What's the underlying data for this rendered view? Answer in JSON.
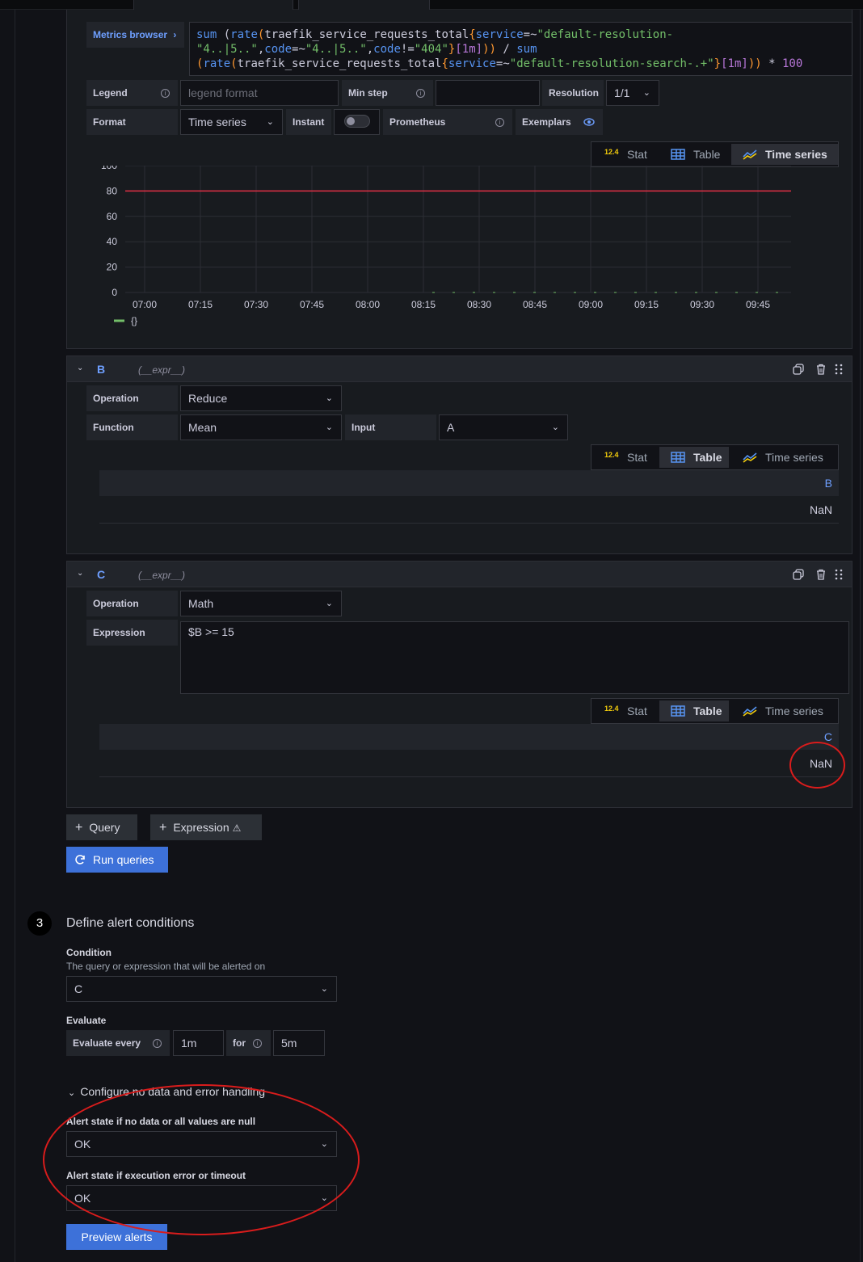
{
  "query_a": {
    "metrics_browser_label": "Metrics browser",
    "metrics_browser_chevron": "›",
    "code_line1_fn": "sum",
    "code_line1_rest_open": " (",
    "code_line1_rate": "rate",
    "code_line1_paren": "(",
    "code_line1_metric": "traefik_service_requests_total",
    "code_line1_brace": "{",
    "code_line1_label": "service",
    "code_line1_op": "=~",
    "code_line1_str": "\"default-resolution-",
    "code_line2_str": "\"4..|5..\"",
    "code_line2_comma": ",",
    "code_line2_label": "code",
    "code_line2_op": "=~",
    "code_line2_comma2": ",",
    "code_line2_label2": "code",
    "code_line2_op2": "!=",
    "code_line2_str2": "\"404\"",
    "code_line2_brace": "}",
    "code_line2_range": "[1m]",
    "code_line2_close": "))",
    "code_line2_div": " / ",
    "code_line2_fn": "sum",
    "code_line3_open": "(",
    "code_line3_rate": "rate",
    "code_line3_paren": "(",
    "code_line3_metric": "traefik_service_requests_total",
    "code_line3_brace": "{",
    "code_line3_label": "service",
    "code_line3_op": "=~",
    "code_line3_str": "\"default-resolution-search-.+\"",
    "code_line3_brace2": "}",
    "code_line3_range": "[1m]",
    "code_line3_close": "))",
    "code_line3_mul": " * ",
    "code_line3_num": "100",
    "legend_label": "Legend",
    "legend_placeholder": "legend format",
    "min_step_label": "Min step",
    "min_step_value": "",
    "resolution_label": "Resolution",
    "resolution_value": "1/1",
    "format_label": "Format",
    "format_value": "Time series",
    "instant_label": "Instant",
    "prometheus_label": "Prometheus",
    "exemplars_label": "Exemplars",
    "viz_tabs": [
      "Stat",
      "Table",
      "Time series"
    ],
    "active_tab": "Time series",
    "stat_icon_text": "12.4",
    "legend_item": "{}"
  },
  "chart_data": {
    "type": "line",
    "y_ticks": [
      "0",
      "20",
      "40",
      "60",
      "80",
      "100"
    ],
    "x_ticks": [
      "07:00",
      "07:15",
      "07:30",
      "07:45",
      "08:00",
      "08:15",
      "08:30",
      "08:45",
      "09:00",
      "09:15",
      "09:30",
      "09:45"
    ],
    "ylim": [
      0,
      100
    ],
    "series": [
      {
        "name": "{}",
        "color": "#73bf69",
        "values": [
          0
        ]
      }
    ],
    "threshold": {
      "value": 80,
      "color": "#e02f44"
    },
    "grid": true,
    "legend_placement": "bottom-left"
  },
  "query_b": {
    "refid": "B",
    "expr_tag": "(__expr__)",
    "operation_label": "Operation",
    "operation_value": "Reduce",
    "function_label": "Function",
    "function_value": "Mean",
    "input_label": "Input",
    "input_value": "A",
    "viz_tabs": [
      "Stat",
      "Table",
      "Time series"
    ],
    "active_tab": "Table",
    "table_header": "B",
    "table_value": "NaN"
  },
  "query_c": {
    "refid": "C",
    "expr_tag": "(__expr__)",
    "operation_label": "Operation",
    "operation_value": "Math",
    "expression_label": "Expression",
    "expression_value": "$B >= 15",
    "viz_tabs": [
      "Stat",
      "Table",
      "Time series"
    ],
    "active_tab": "Table",
    "table_header": "C",
    "table_value": "NaN"
  },
  "actions": {
    "query_button": "Query",
    "expression_button": "Expression",
    "run_queries_button": "Run queries",
    "plus": "+",
    "warn": "⚠"
  },
  "section3": {
    "step": "3",
    "title": "Define alert conditions",
    "condition_title": "Condition",
    "condition_desc": "The query or expression that will be alerted on",
    "condition_value": "C",
    "evaluate_title": "Evaluate",
    "evaluate_every_label": "Evaluate every",
    "evaluate_every_value": "1m",
    "for_label": "for",
    "for_value": "5m",
    "configure_toggle": "Configure no data and error handling",
    "no_data_title": "Alert state if no data or all values are null",
    "no_data_value": "OK",
    "exec_error_title": "Alert state if execution error or timeout",
    "exec_error_value": "OK",
    "preview_button": "Preview alerts"
  },
  "colors": {
    "annotation_red": "#d91c1c",
    "accent_blue": "#3d71d9",
    "threshold_red": "#e02f44"
  }
}
